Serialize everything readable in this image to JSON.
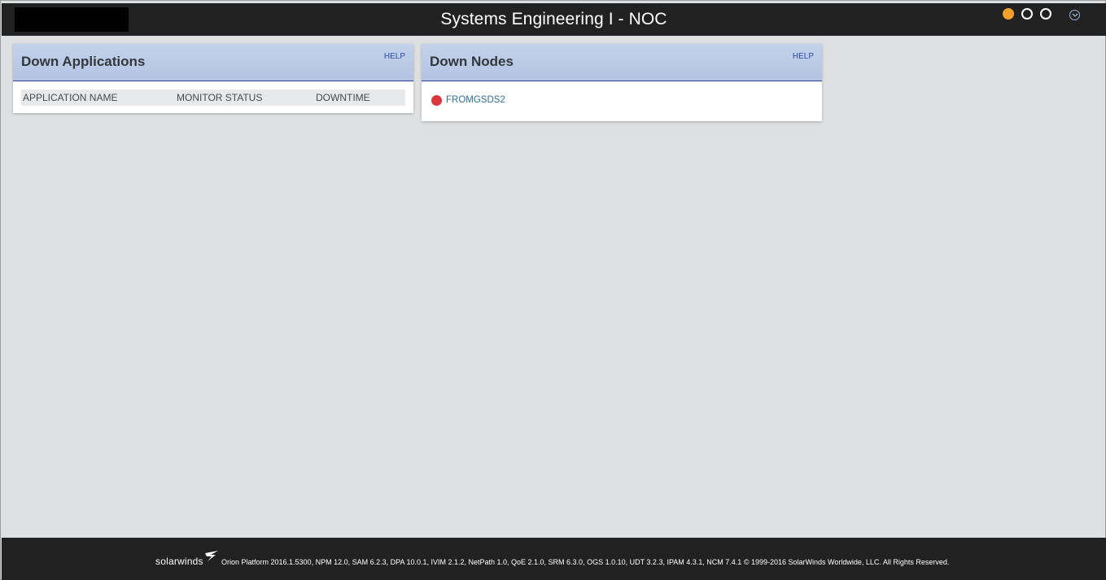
{
  "header": {
    "title": "Systems Engineering I - NOC",
    "page_dots": [
      "active",
      "inactive",
      "inactive"
    ],
    "menu_icon": "chevron-down-icon"
  },
  "panels": {
    "down_applications": {
      "title": "Down Applications",
      "help": "HELP",
      "columns": [
        "APPLICATION NAME",
        "MONITOR STATUS",
        "DOWNTIME"
      ]
    },
    "down_nodes": {
      "title": "Down Nodes",
      "help": "HELP",
      "nodes": [
        {
          "name": "FROMGSDS2",
          "status": "down"
        }
      ]
    }
  },
  "footer": {
    "brand": "solarwinds",
    "text": "Orion Platform 2016.1.5300, NPM 12.0, SAM 6.2.3, DPA 10.0.1, IVIM 2.1.2, NetPath 1.0, QoE 2.1.0, SRM 6.3.0, OGS 1.0.10, UDT 3.2.3, IPAM 4.3.1, NCM 7.4.1 © 1999-2016 SolarWinds Worldwide, LLC. All Rights Reserved."
  },
  "colors": {
    "header_bg": "#212121",
    "active_dot": "#f7a12b",
    "panel_header": "#b3c4e3",
    "link": "#2d6d97",
    "status_down": "#d9363e"
  }
}
